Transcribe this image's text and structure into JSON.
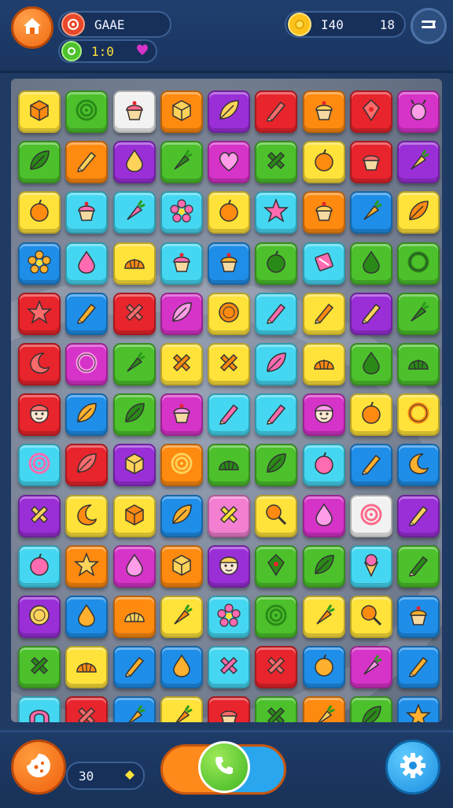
{
  "header": {
    "player_label": "GAAE",
    "moves_label": "1:0",
    "coins_value": "I40",
    "level_value": "18",
    "icons": {
      "home": "house-icon",
      "player": "swirl-candy-icon",
      "moves": "green-swirl-icon",
      "heart": "heart-icon",
      "coin": "coin-icon",
      "menu": "menu-icon"
    }
  },
  "footer": {
    "score_value": "30",
    "icons": {
      "profile": "cookie-icon",
      "call": "phone-icon",
      "settings": "gear-icon"
    }
  },
  "colors": {
    "red": "#e8242c",
    "green": "#4cc12c",
    "orange": "#ff8a10",
    "yellow": "#ffe23a",
    "purple": "#9a2fd8",
    "blue": "#1f8ee8",
    "cyan": "#45d7f2",
    "magenta": "#d633c8",
    "white": "#f2f2f2",
    "pink": "#f27fd0"
  },
  "board": {
    "grid_size": "9x13",
    "tiles": [
      [
        {
          "c": "yellow",
          "i": "cube"
        },
        {
          "c": "green",
          "i": "swirl"
        },
        {
          "c": "white",
          "i": "cupcake"
        },
        {
          "c": "orange",
          "i": "cube"
        },
        {
          "c": "purple",
          "i": "leaf"
        },
        {
          "c": "red",
          "i": "pencil"
        },
        {
          "c": "orange",
          "i": "cupcake"
        },
        {
          "c": "red",
          "i": "gem"
        },
        {
          "c": "magenta",
          "i": "bug"
        }
      ],
      [
        {
          "c": "green",
          "i": "leaf"
        },
        {
          "c": "orange",
          "i": "pencil"
        },
        {
          "c": "purple",
          "i": "drop"
        },
        {
          "c": "green",
          "i": "carrot"
        },
        {
          "c": "magenta",
          "i": "heart"
        },
        {
          "c": "green",
          "i": "cross"
        },
        {
          "c": "yellow",
          "i": "fruit"
        },
        {
          "c": "red",
          "i": "cupcake"
        },
        {
          "c": "purple",
          "i": "carrot"
        }
      ],
      [
        {
          "c": "yellow",
          "i": "fruit"
        },
        {
          "c": "cyan",
          "i": "cupcake"
        },
        {
          "c": "cyan",
          "i": "carrot"
        },
        {
          "c": "cyan",
          "i": "flower"
        },
        {
          "c": "yellow",
          "i": "fruit"
        },
        {
          "c": "cyan",
          "i": "star"
        },
        {
          "c": "orange",
          "i": "cupcake"
        },
        {
          "c": "blue",
          "i": "carrot"
        },
        {
          "c": "yellow",
          "i": "leaf"
        }
      ],
      [
        {
          "c": "blue",
          "i": "flower"
        },
        {
          "c": "cyan",
          "i": "drop"
        },
        {
          "c": "yellow",
          "i": "shell"
        },
        {
          "c": "cyan",
          "i": "cupcake"
        },
        {
          "c": "blue",
          "i": "cupcake"
        },
        {
          "c": "green",
          "i": "fruit"
        },
        {
          "c": "cyan",
          "i": "candy"
        },
        {
          "c": "green",
          "i": "drop"
        },
        {
          "c": "green",
          "i": "ring"
        }
      ],
      [
        {
          "c": "red",
          "i": "star"
        },
        {
          "c": "blue",
          "i": "pencil"
        },
        {
          "c": "red",
          "i": "cross"
        },
        {
          "c": "magenta",
          "i": "leaf"
        },
        {
          "c": "yellow",
          "i": "coin"
        },
        {
          "c": "cyan",
          "i": "pencil"
        },
        {
          "c": "yellow",
          "i": "pencil"
        },
        {
          "c": "purple",
          "i": "pencil"
        },
        {
          "c": "green",
          "i": "carrot"
        }
      ],
      [
        {
          "c": "red",
          "i": "moon"
        },
        {
          "c": "magenta",
          "i": "ring"
        },
        {
          "c": "green",
          "i": "carrot"
        },
        {
          "c": "yellow",
          "i": "cross"
        },
        {
          "c": "yellow",
          "i": "cross"
        },
        {
          "c": "cyan",
          "i": "leaf"
        },
        {
          "c": "yellow",
          "i": "shell"
        },
        {
          "c": "green",
          "i": "drop"
        },
        {
          "c": "green",
          "i": "shell"
        }
      ],
      [
        {
          "c": "red",
          "i": "face"
        },
        {
          "c": "blue",
          "i": "leaf"
        },
        {
          "c": "green",
          "i": "leaf"
        },
        {
          "c": "magenta",
          "i": "cupcake"
        },
        {
          "c": "cyan",
          "i": "pencil"
        },
        {
          "c": "cyan",
          "i": "pencil"
        },
        {
          "c": "magenta",
          "i": "face"
        },
        {
          "c": "yellow",
          "i": "fruit"
        },
        {
          "c": "yellow",
          "i": "ring"
        }
      ],
      [
        {
          "c": "cyan",
          "i": "swirl"
        },
        {
          "c": "red",
          "i": "leaf"
        },
        {
          "c": "purple",
          "i": "cube"
        },
        {
          "c": "orange",
          "i": "swirl"
        },
        {
          "c": "green",
          "i": "shell"
        },
        {
          "c": "green",
          "i": "leaf"
        },
        {
          "c": "cyan",
          "i": "fruit"
        },
        {
          "c": "blue",
          "i": "pencil"
        },
        {
          "c": "blue",
          "i": "moon"
        }
      ],
      [
        {
          "c": "purple",
          "i": "cross"
        },
        {
          "c": "yellow",
          "i": "moon"
        },
        {
          "c": "yellow",
          "i": "cube"
        },
        {
          "c": "blue",
          "i": "leaf"
        },
        {
          "c": "pink",
          "i": "cross"
        },
        {
          "c": "yellow",
          "i": "lolly"
        },
        {
          "c": "magenta",
          "i": "drop"
        },
        {
          "c": "white",
          "i": "swirl"
        },
        {
          "c": "purple",
          "i": "pencil"
        }
      ],
      [
        {
          "c": "cyan",
          "i": "fruit"
        },
        {
          "c": "orange",
          "i": "star"
        },
        {
          "c": "magenta",
          "i": "drop"
        },
        {
          "c": "orange",
          "i": "cube"
        },
        {
          "c": "purple",
          "i": "face"
        },
        {
          "c": "green",
          "i": "gem"
        },
        {
          "c": "green",
          "i": "leaf"
        },
        {
          "c": "cyan",
          "i": "cone"
        },
        {
          "c": "green",
          "i": "pencil"
        }
      ],
      [
        {
          "c": "purple",
          "i": "coin"
        },
        {
          "c": "blue",
          "i": "drop"
        },
        {
          "c": "orange",
          "i": "shell"
        },
        {
          "c": "yellow",
          "i": "carrot"
        },
        {
          "c": "cyan",
          "i": "flower"
        },
        {
          "c": "green",
          "i": "swirl"
        },
        {
          "c": "yellow",
          "i": "carrot"
        },
        {
          "c": "yellow",
          "i": "lolly"
        },
        {
          "c": "blue",
          "i": "cupcake"
        }
      ],
      [
        {
          "c": "green",
          "i": "cross"
        },
        {
          "c": "yellow",
          "i": "shell"
        },
        {
          "c": "blue",
          "i": "pencil"
        },
        {
          "c": "blue",
          "i": "drop"
        },
        {
          "c": "cyan",
          "i": "cross"
        },
        {
          "c": "red",
          "i": "cross"
        },
        {
          "c": "blue",
          "i": "fruit"
        },
        {
          "c": "magenta",
          "i": "carrot"
        },
        {
          "c": "blue",
          "i": "pencil"
        }
      ],
      [
        {
          "c": "cyan",
          "i": "arch"
        },
        {
          "c": "red",
          "i": "cross"
        },
        {
          "c": "blue",
          "i": "carrot"
        },
        {
          "c": "yellow",
          "i": "carrot"
        },
        {
          "c": "red",
          "i": "cupcake"
        },
        {
          "c": "green",
          "i": "cross"
        },
        {
          "c": "orange",
          "i": "carrot"
        },
        {
          "c": "green",
          "i": "leaf"
        },
        {
          "c": "blue",
          "i": "star"
        }
      ]
    ]
  }
}
